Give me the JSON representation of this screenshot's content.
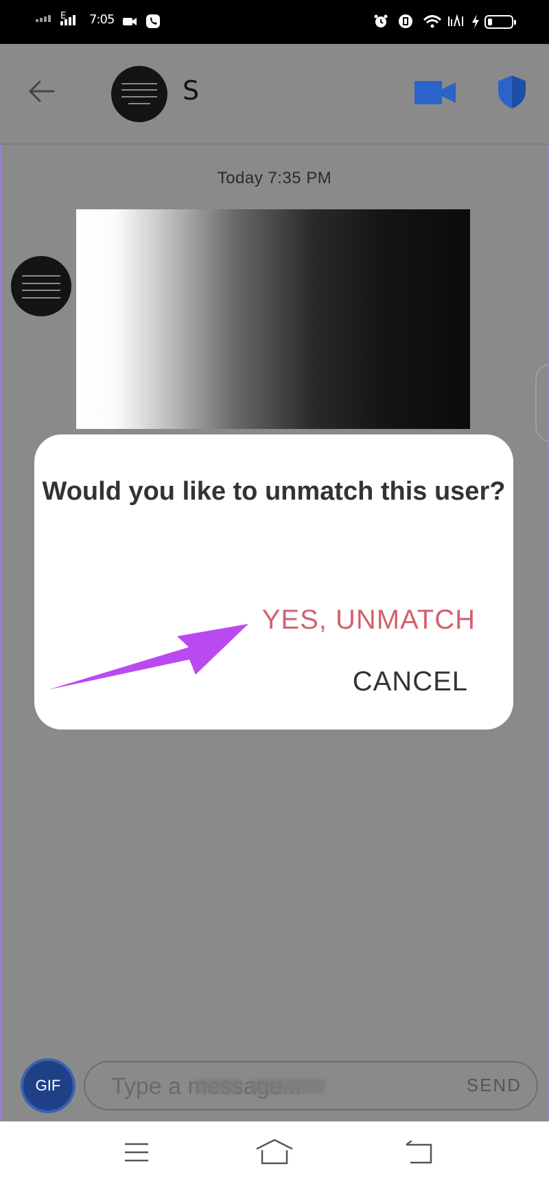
{
  "status_bar": {
    "time": "7:05",
    "network_label": "E"
  },
  "header": {
    "back_icon": "back-arrow-icon",
    "contact_name": "S",
    "video_icon": "video-camera-icon",
    "safety_icon": "shield-icon"
  },
  "chat": {
    "timestamp": "Today 7:35 PM"
  },
  "dialog": {
    "title": "Would you like to unmatch this user?",
    "confirm_label": "YES, UNMATCH",
    "cancel_label": "CANCEL"
  },
  "composer": {
    "gif_label": "GIF",
    "placeholder": "Type a message...",
    "send_label": "SEND"
  },
  "colors": {
    "accent_red": "#d4606e",
    "arrow_purple": "#b94af2",
    "gif_blue": "#1f3f86",
    "shield_blue": "#2a63c9"
  }
}
